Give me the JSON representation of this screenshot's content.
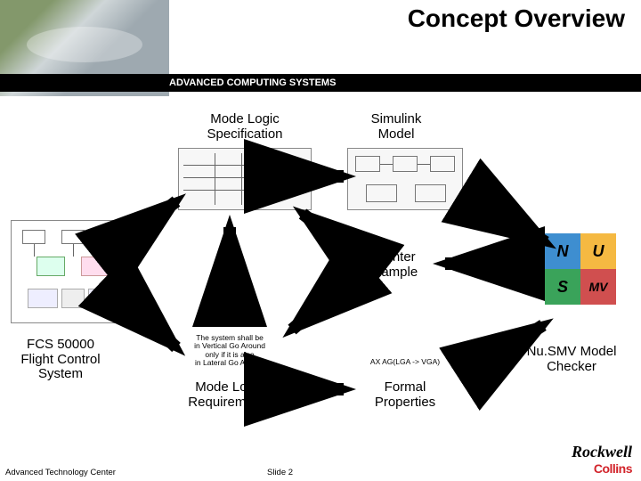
{
  "header": {
    "title": "Concept Overview"
  },
  "banner": {
    "text": "ADVANCED COMPUTING SYSTEMS"
  },
  "nodes": {
    "mode_logic_spec": "Mode Logic\nSpecification",
    "simulink_model": "Simulink\nModel",
    "counter_example": "Counter\nExample",
    "fcs": "FCS 50000\nFlight Control\nSystem",
    "requirement_text": "The system shall be\nin Vertical Go Around\nonly if it is also\nin Lateral Go Around",
    "mode_logic_req": "Mode Logic\nRequirements",
    "formal_prop_expr": "AX AG(LGA -> VGA)",
    "formal_props": "Formal\nProperties",
    "nusmv": "Nu.SMV Model\nChecker"
  },
  "puzzle": {
    "tl": "N",
    "tr": "U",
    "bl": "S",
    "br": "MV"
  },
  "footer": {
    "left": "Advanced Technology Center",
    "slide": "Slide 2",
    "logo_top": "Rockwell",
    "logo_bot": "Collins"
  }
}
